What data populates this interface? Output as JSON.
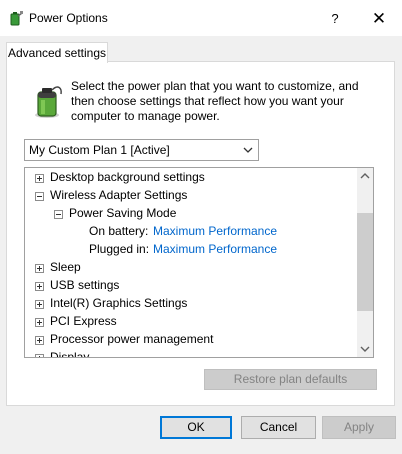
{
  "window": {
    "title": "Power Options",
    "help_label": "?",
    "close_label": "✕"
  },
  "tab": {
    "label": "Advanced settings"
  },
  "description": "Select the power plan that you want to customize, and then choose settings that reflect how you want your computer to manage power.",
  "plan_select": {
    "value": "My Custom Plan 1 [Active]"
  },
  "tree": {
    "items": [
      {
        "label": "Desktop background settings",
        "expanded": false
      },
      {
        "label": "Wireless Adapter Settings",
        "expanded": true
      },
      {
        "label": "Power Saving Mode",
        "expanded": true
      },
      {
        "label": "On battery:",
        "value": "Maximum Performance"
      },
      {
        "label": "Plugged in:",
        "value": "Maximum Performance"
      },
      {
        "label": "Sleep",
        "expanded": false
      },
      {
        "label": "USB settings",
        "expanded": false
      },
      {
        "label": "Intel(R) Graphics Settings",
        "expanded": false
      },
      {
        "label": "PCI Express",
        "expanded": false
      },
      {
        "label": "Processor power management",
        "expanded": false
      },
      {
        "label": "Display",
        "expanded": false
      }
    ]
  },
  "buttons": {
    "restore": "Restore plan defaults",
    "ok": "OK",
    "cancel": "Cancel",
    "apply": "Apply"
  },
  "colors": {
    "link": "#0066cc",
    "focus": "#0078d7"
  },
  "icons": {
    "app": "battery-plug-icon",
    "battery": "battery-icon",
    "dropdown": "chevron-down-icon"
  }
}
